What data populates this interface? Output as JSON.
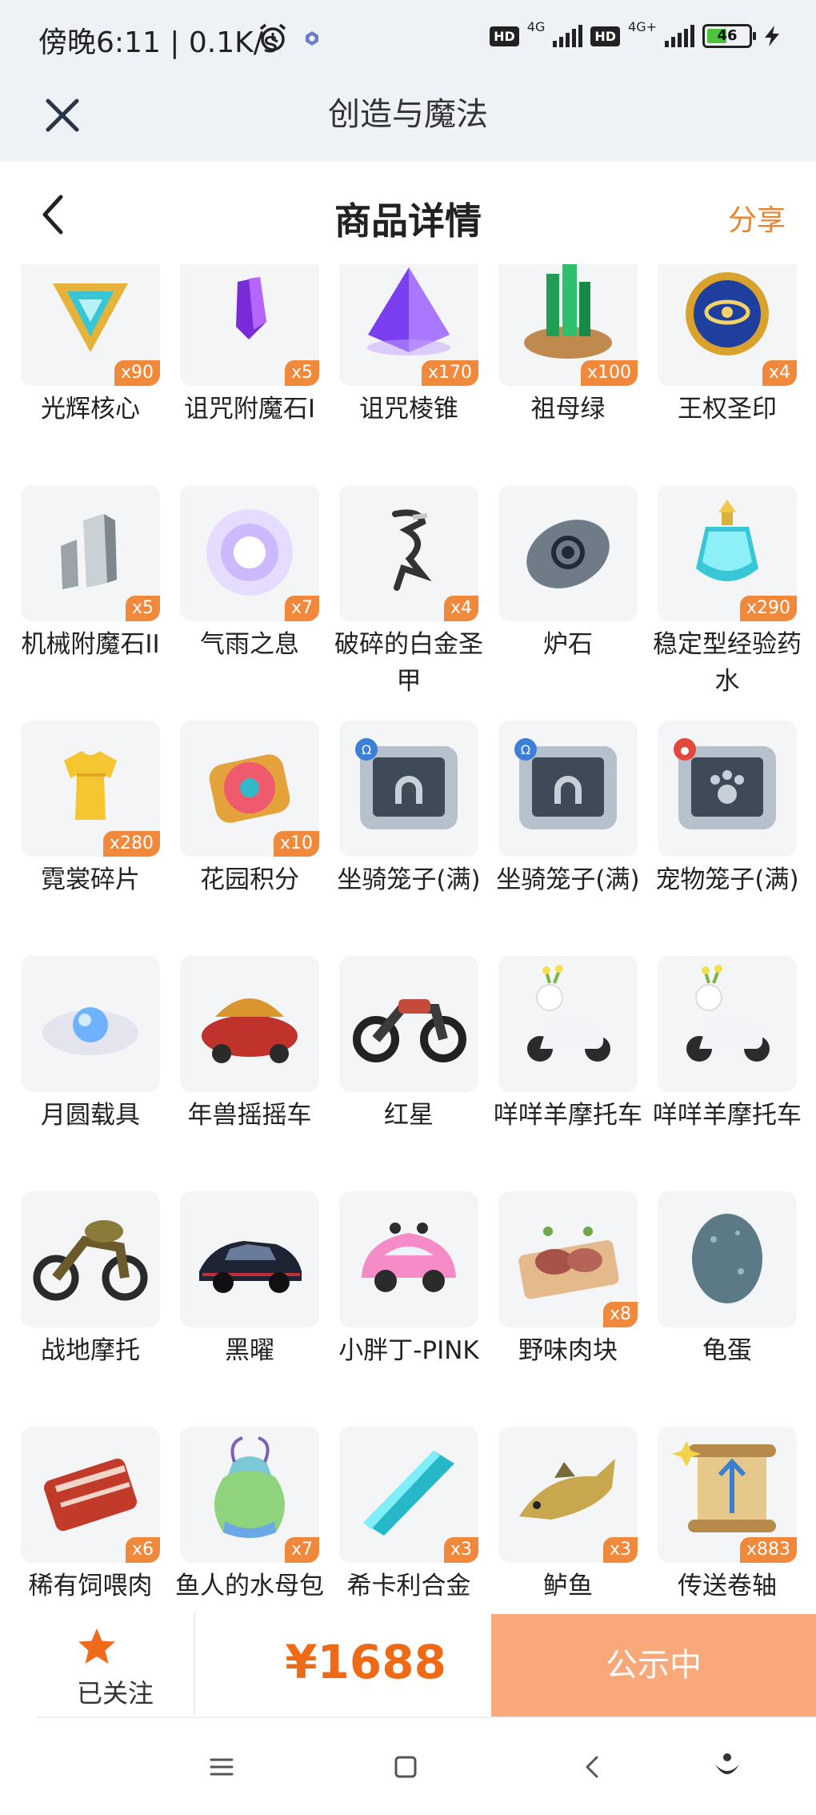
{
  "status_bar": {
    "time": "傍晚6:11 | 0.1K/s",
    "hd1": "HD",
    "net1": "4G",
    "hd2": "HD",
    "net2": "4G+",
    "battery": "46"
  },
  "app_header": {
    "title": "创造与魔法"
  },
  "page_header": {
    "title": "商品详情",
    "share": "分享"
  },
  "items": [
    {
      "name": "光辉核心",
      "qty": "x90",
      "icon": "radiant-core-icon"
    },
    {
      "name": "诅咒附魔石I",
      "qty": "x5",
      "icon": "cursed-enchant-stone-icon"
    },
    {
      "name": "诅咒棱锥",
      "qty": "x170",
      "icon": "cursed-pyramid-icon"
    },
    {
      "name": "祖母绿",
      "qty": "x100",
      "icon": "emerald-icon"
    },
    {
      "name": "王权圣印",
      "qty": "x4",
      "icon": "royal-seal-icon"
    },
    {
      "name": "机械附魔石II",
      "qty": "x5",
      "icon": "mech-enchant-stone-icon"
    },
    {
      "name": "气雨之息",
      "qty": "x7",
      "icon": "breath-orb-icon"
    },
    {
      "name": "破碎的白金圣甲",
      "qty": "x4",
      "icon": "broken-armor-icon"
    },
    {
      "name": "炉石",
      "qty": "",
      "icon": "hearthstone-icon"
    },
    {
      "name": "稳定型经验药水",
      "qty": "x290",
      "icon": "exp-potion-icon"
    },
    {
      "name": "霓裳碎片",
      "qty": "x280",
      "icon": "outfit-shard-icon"
    },
    {
      "name": "花园积分",
      "qty": "x10",
      "icon": "garden-points-icon"
    },
    {
      "name": "坐骑笼子(满)",
      "qty": "",
      "icon": "mount-cage-icon"
    },
    {
      "name": "坐骑笼子(满)",
      "qty": "",
      "icon": "mount-cage-icon"
    },
    {
      "name": "宠物笼子(满)",
      "qty": "",
      "icon": "pet-cage-icon"
    },
    {
      "name": "月圆载具",
      "qty": "",
      "icon": "full-moon-vehicle-icon"
    },
    {
      "name": "年兽摇摇车",
      "qty": "",
      "icon": "nian-beast-car-icon"
    },
    {
      "name": "红星",
      "qty": "",
      "icon": "red-star-motorcycle-icon"
    },
    {
      "name": "咩咩羊摩托车",
      "qty": "",
      "icon": "sheep-scooter-icon"
    },
    {
      "name": "咩咩羊摩托车",
      "qty": "",
      "icon": "sheep-scooter-icon"
    },
    {
      "name": "战地摩托",
      "qty": "",
      "icon": "battle-motorcycle-icon"
    },
    {
      "name": "黑曜",
      "qty": "",
      "icon": "obsidian-car-icon"
    },
    {
      "name": "小胖丁-PINK",
      "qty": "",
      "icon": "pink-beetle-car-icon"
    },
    {
      "name": "野味肉块",
      "qty": "x8",
      "icon": "game-meat-icon"
    },
    {
      "name": "龟蛋",
      "qty": "",
      "icon": "turtle-egg-icon"
    },
    {
      "name": "稀有饲喂肉",
      "qty": "x6",
      "icon": "rare-feed-meat-icon"
    },
    {
      "name": "鱼人的水母包",
      "qty": "x7",
      "icon": "jellyfish-bag-icon"
    },
    {
      "name": "希卡利合金",
      "qty": "x3",
      "icon": "sheikah-alloy-icon"
    },
    {
      "name": "鲈鱼",
      "qty": "x3",
      "icon": "perch-fish-icon"
    },
    {
      "name": "传送卷轴",
      "qty": "x883",
      "icon": "teleport-scroll-icon"
    }
  ],
  "bottom_bar": {
    "follow_label": "已关注",
    "price": "¥1688",
    "status_button": "公示中"
  },
  "colors": {
    "accent": "#e8842f",
    "price": "#ef6a16",
    "qty_badge": "#f0893c",
    "status_button": "#f9a879",
    "header_bg": "#eef2f7"
  }
}
